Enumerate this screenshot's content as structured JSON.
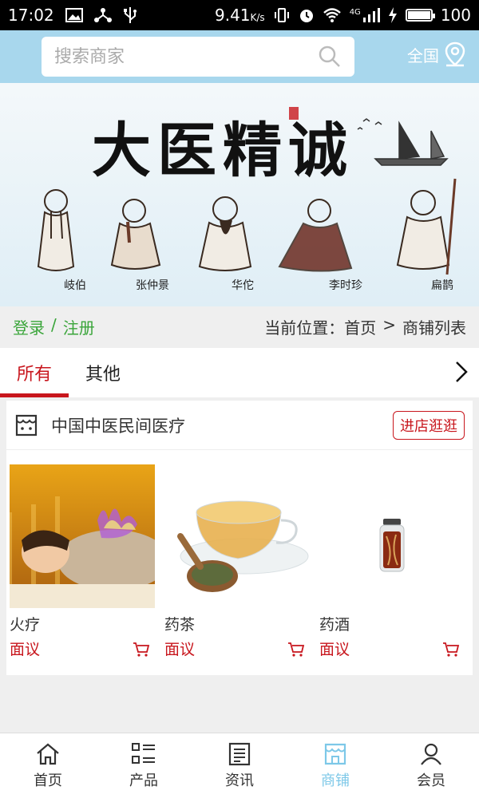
{
  "status_bar": {
    "time": "17:02",
    "speed": "9.41",
    "speed_unit": "K/s",
    "network": "4G",
    "battery": "100"
  },
  "header": {
    "search_placeholder": "搜索商家",
    "region": "全国"
  },
  "banner": {
    "calligraphy": "大医精诚",
    "figures": [
      "岐伯",
      "张仲景",
      "华佗",
      "李时珍",
      "扁鹊"
    ]
  },
  "login_bar": {
    "login": "登录",
    "separator": "/",
    "register": "注册",
    "location_prefix": "当前位置：",
    "crumb_home": "首页",
    "crumb_sep": ">",
    "crumb_current": "商铺列表"
  },
  "tabs": [
    {
      "label": "所有",
      "active": true
    },
    {
      "label": "其他",
      "active": false
    }
  ],
  "shop": {
    "name": "中国中医民间医疗",
    "visit_button": "进店逛逛",
    "products": [
      {
        "name": "火疗",
        "price": "面议",
        "image": "fire-therapy-photo"
      },
      {
        "name": "药茶",
        "price": "面议",
        "image": "herbal-tea-photo"
      },
      {
        "name": "药酒",
        "price": "面议",
        "image": "medicinal-wine-photo"
      }
    ]
  },
  "bottom_nav": [
    {
      "label": "首页",
      "icon": "home-icon",
      "active": false
    },
    {
      "label": "产品",
      "icon": "list-icon",
      "active": false
    },
    {
      "label": "资讯",
      "icon": "news-icon",
      "active": false
    },
    {
      "label": "商铺",
      "icon": "store-icon",
      "active": true
    },
    {
      "label": "会员",
      "icon": "user-icon",
      "active": false
    }
  ],
  "colors": {
    "accent": "#c8161d",
    "header_bg": "#a8d7ed",
    "link_green": "#3aa53a",
    "nav_active": "#7dc8e8"
  }
}
